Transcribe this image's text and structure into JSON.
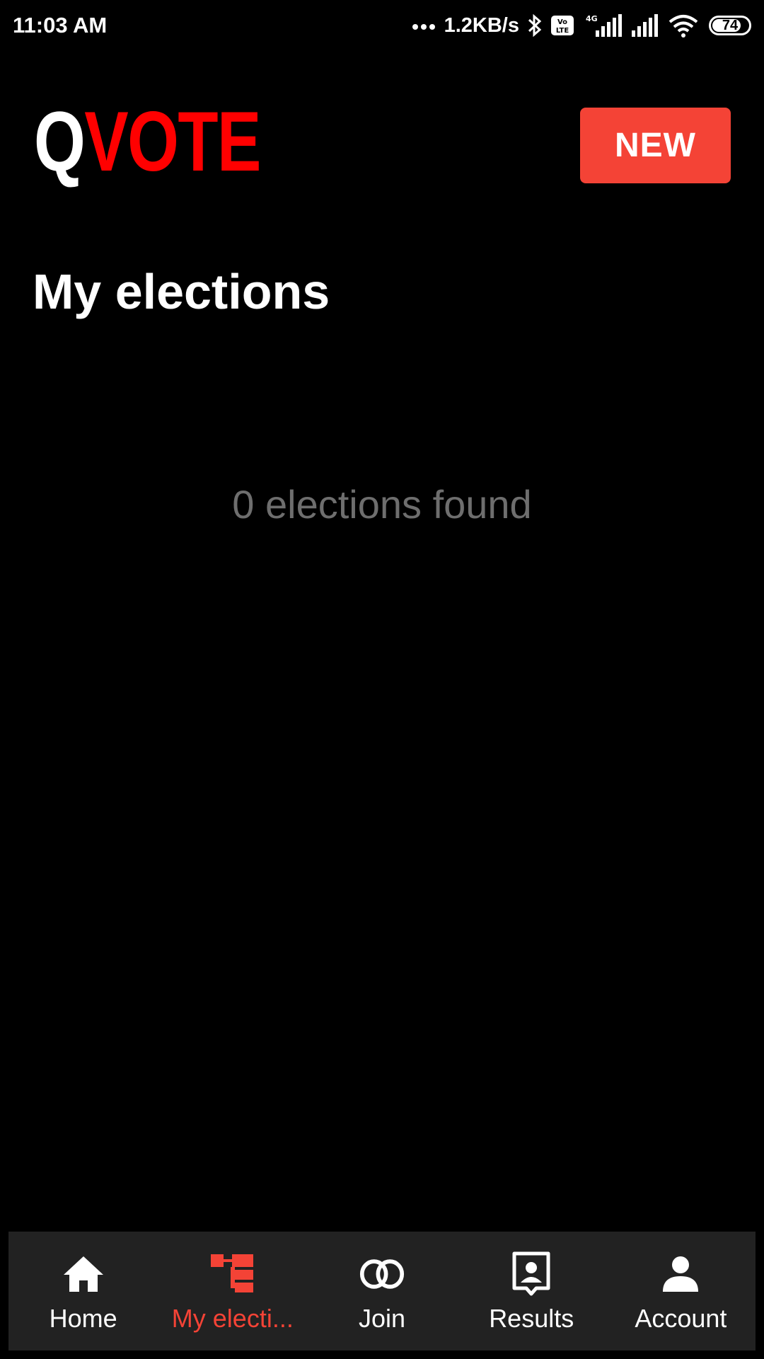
{
  "status_bar": {
    "time": "11:03 AM",
    "network_speed": "1.2KB/s",
    "battery_level": "74",
    "icons": [
      "more-dots-icon",
      "bluetooth-icon",
      "volte-icon",
      "signal-4g-icon",
      "signal-icon",
      "wifi-icon",
      "battery-icon"
    ]
  },
  "header": {
    "logo_q": "Q",
    "logo_vote": "VOTE",
    "new_button_label": "NEW"
  },
  "main": {
    "title": "My elections",
    "empty_message": "0 elections found"
  },
  "bottom_nav": {
    "items": [
      {
        "label": "Home",
        "icon": "home-icon",
        "active": false
      },
      {
        "label": "My electi...",
        "icon": "sitemap-icon",
        "active": true
      },
      {
        "label": "Join",
        "icon": "rings-icon",
        "active": false
      },
      {
        "label": "Results",
        "icon": "portrait-chat-icon",
        "active": false
      },
      {
        "label": "Account",
        "icon": "person-icon",
        "active": false
      }
    ]
  },
  "colors": {
    "background": "#000000",
    "accent": "#f44336",
    "logo_red": "#ff0000",
    "nav_background": "#222222",
    "muted_text": "#6e6e6e"
  }
}
